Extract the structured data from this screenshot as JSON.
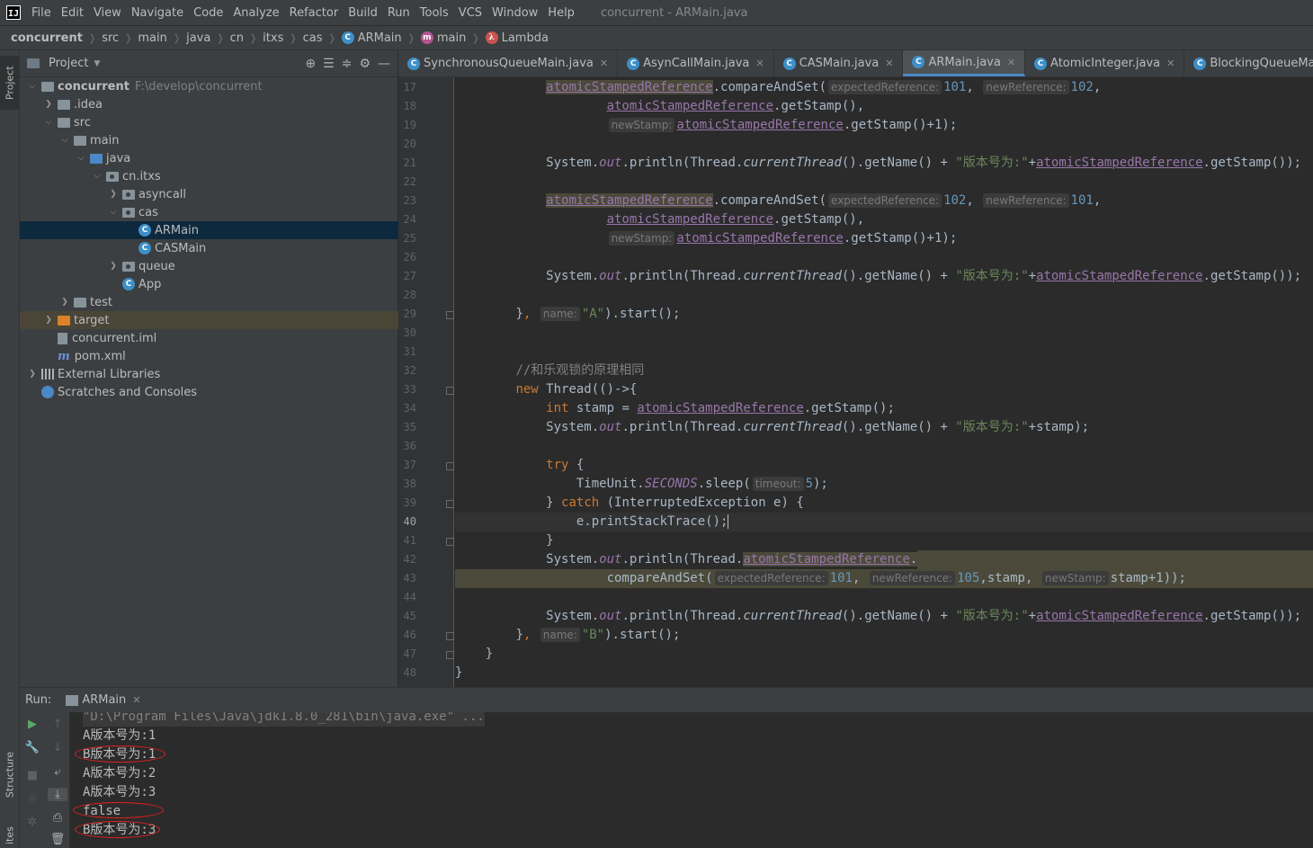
{
  "app": {
    "logo_text": "IJ",
    "window_title": "concurrent - ARMain.java"
  },
  "menu": [
    "File",
    "Edit",
    "View",
    "Navigate",
    "Code",
    "Analyze",
    "Refactor",
    "Build",
    "Run",
    "Tools",
    "VCS",
    "Window",
    "Help"
  ],
  "breadcrumb": [
    "concurrent",
    "src",
    "main",
    "java",
    "cn",
    "itxs",
    "cas",
    "ARMain",
    "main",
    "Lambda"
  ],
  "project_panel": {
    "title": "Project",
    "tree": [
      {
        "label": "concurrent",
        "extra": "F:\\develop\\concurrent",
        "depth": 0,
        "expanded": true,
        "icon": "module-folder-icon",
        "bold": true
      },
      {
        "label": ".idea",
        "depth": 1,
        "expanded": false,
        "icon": "folder-icon"
      },
      {
        "label": "src",
        "depth": 1,
        "expanded": true,
        "icon": "folder-icon"
      },
      {
        "label": "main",
        "depth": 2,
        "expanded": true,
        "icon": "folder-icon"
      },
      {
        "label": "java",
        "depth": 3,
        "expanded": true,
        "icon": "source-folder-icon"
      },
      {
        "label": "cn.itxs",
        "depth": 4,
        "expanded": true,
        "icon": "package-icon"
      },
      {
        "label": "asyncall",
        "depth": 5,
        "expanded": false,
        "icon": "package-icon"
      },
      {
        "label": "cas",
        "depth": 5,
        "expanded": true,
        "icon": "package-icon"
      },
      {
        "label": "ARMain",
        "depth": 6,
        "icon": "java-class-icon",
        "selected": true
      },
      {
        "label": "CASMain",
        "depth": 6,
        "icon": "java-class-icon"
      },
      {
        "label": "queue",
        "depth": 5,
        "expanded": false,
        "icon": "package-icon"
      },
      {
        "label": "App",
        "depth": 5,
        "icon": "java-class-icon"
      },
      {
        "label": "test",
        "depth": 2,
        "expanded": false,
        "icon": "folder-icon"
      },
      {
        "label": "target",
        "depth": 1,
        "expanded": false,
        "icon": "excluded-folder-icon",
        "excluded": true
      },
      {
        "label": "concurrent.iml",
        "depth": 1,
        "icon": "iml-file-icon"
      },
      {
        "label": "pom.xml",
        "depth": 1,
        "icon": "maven-icon"
      },
      {
        "label": "External Libraries",
        "depth": 0,
        "expanded": false,
        "icon": "libraries-icon"
      },
      {
        "label": "Scratches and Consoles",
        "depth": 0,
        "icon": "scratches-icon"
      }
    ]
  },
  "editor_tabs": [
    {
      "label": "SynchronousQueueMain.java",
      "active": false
    },
    {
      "label": "AsynCallMain.java",
      "active": false
    },
    {
      "label": "CASMain.java",
      "active": false
    },
    {
      "label": "ARMain.java",
      "active": true
    },
    {
      "label": "AtomicInteger.java",
      "active": false
    },
    {
      "label": "BlockingQueueMain.java",
      "active": false
    }
  ],
  "editor": {
    "current_line": 40,
    "line_numbers": [
      "17",
      "18",
      "19",
      "20",
      "21",
      "22",
      "23",
      "24",
      "25",
      "26",
      "27",
      "28",
      "29",
      "30",
      "31",
      "32",
      "33",
      "34",
      "35",
      "36",
      "37",
      "38",
      "39",
      "40",
      "41",
      "42",
      "43",
      "44",
      "45",
      "46",
      "47",
      "48"
    ],
    "hints": {
      "expected": "expectedReference:",
      "new_ref": "newReference:",
      "new_stamp": "newStamp:",
      "name": "name:",
      "timeout": "timeout:"
    },
    "tokens": {
      "asr": "atomicStampedReference",
      "compare": ".compareAndSet(",
      "compare_plain": "compareAndSet(",
      "get_stamp": ".getStamp()",
      "get_stamp_plus": ".getStamp()+1);",
      "system": "System.",
      "out": "out",
      "println_thread": ".println(Thread.",
      "current_thread": "currentThread",
      "get_name_concat": "().getName() + ",
      "version_str": "\"版本号为:\"",
      "plus": "+",
      "close_getstamp": ".getStamp());",
      "stamp_plus_close": "+stamp);",
      "comment": "//和乐观锁的原理相同",
      "kw_new": "new",
      "thread_lambda": " Thread(()->{",
      "kw_int": "int",
      "stamp_assign": " stamp = ",
      "stamp_end": ".getStamp();",
      "kw_try": "try",
      "brace_open": " {",
      "timeunit": "TimeUnit.",
      "seconds": "SECONDS",
      "sleep": ".sleep(",
      "kw_catch": "catch",
      "catch_rest": " (InterruptedException e) {",
      "print_stack": "e.printStackTrace();",
      "close_brace": "}",
      "a_name": "\"A\"",
      "b_name": "\"B\"",
      "start": ").start();",
      "n101": "101",
      "n102": "102",
      "n105": "105",
      "n5": "5",
      "stamp_word": "stamp",
      "stamp_plus_one": "stamp+1));",
      "dot": ".",
      "comma": ",",
      "close_paren_comma": "),",
      "close_paren_semicolon": ");"
    }
  },
  "run_panel": {
    "label": "Run:",
    "config": "ARMain",
    "console": [
      "\"D:\\Program Files\\Java\\jdk1.8.0_281\\bin\\java.exe\" ...",
      "A版本号为:1",
      "B版本号为:1",
      "A版本号为:2",
      "A版本号为:3",
      "false",
      "B版本号为:3"
    ]
  },
  "stripe": {
    "project": "Project",
    "structure": "Structure",
    "favorites": "ites"
  },
  "colors": {
    "background": "#2b2b2b",
    "keyword": "#cc7832",
    "field": "#9876aa",
    "string": "#6a8759",
    "number": "#6897bb",
    "selection": "#0d293e",
    "annotation_circle": "#e02020"
  }
}
